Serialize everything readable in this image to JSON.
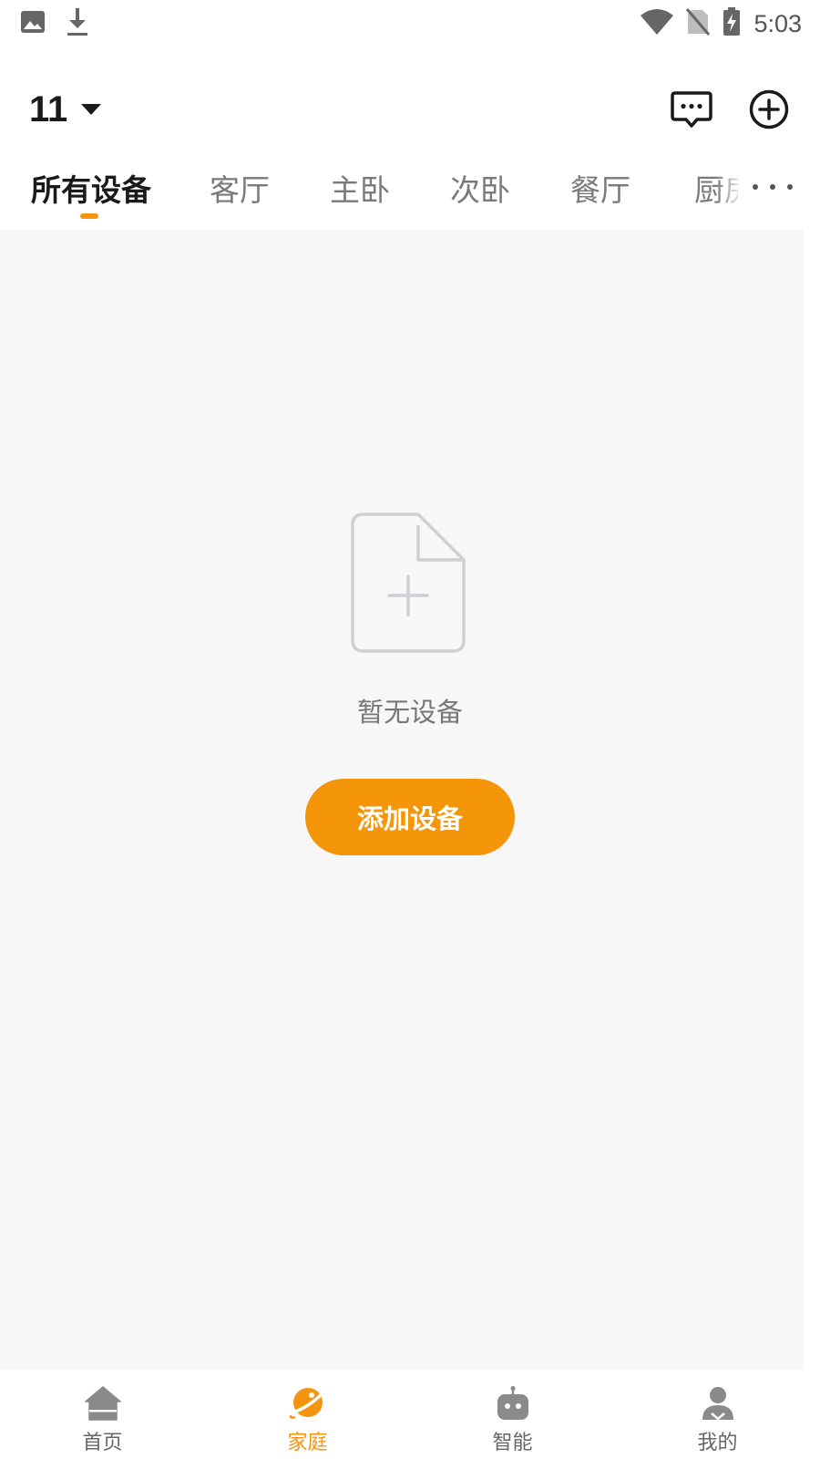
{
  "status_bar": {
    "time": "5:03",
    "icons": [
      "image-icon",
      "download-icon",
      "wifi-icon",
      "no-sim-icon",
      "battery-charging-icon"
    ]
  },
  "header": {
    "home_name": "11",
    "icons": [
      "dropdown-caret-icon",
      "message-icon",
      "add-circle-icon"
    ]
  },
  "tabs": {
    "items": [
      {
        "label": "所有设备",
        "active": true
      },
      {
        "label": "客厅",
        "active": false
      },
      {
        "label": "主卧",
        "active": false
      },
      {
        "label": "次卧",
        "active": false
      },
      {
        "label": "餐厅",
        "active": false
      },
      {
        "label": "厨房",
        "active": false
      }
    ],
    "more_icon": "more-dots-icon"
  },
  "empty_state": {
    "icon": "add-file-icon",
    "message": "暂无设备",
    "button_label": "添加设备"
  },
  "bottom_nav": {
    "items": [
      {
        "label": "首页",
        "icon": "home-icon",
        "active": false
      },
      {
        "label": "家庭",
        "icon": "planet-icon",
        "active": true
      },
      {
        "label": "智能",
        "icon": "robot-icon",
        "active": false
      },
      {
        "label": "我的",
        "icon": "user-icon",
        "active": false
      }
    ]
  },
  "colors": {
    "accent": "#f5950f",
    "button": "#f5950a",
    "background": "#f7f7f7",
    "text_primary": "#1a1a1a",
    "text_secondary": "#7a7a7a"
  }
}
